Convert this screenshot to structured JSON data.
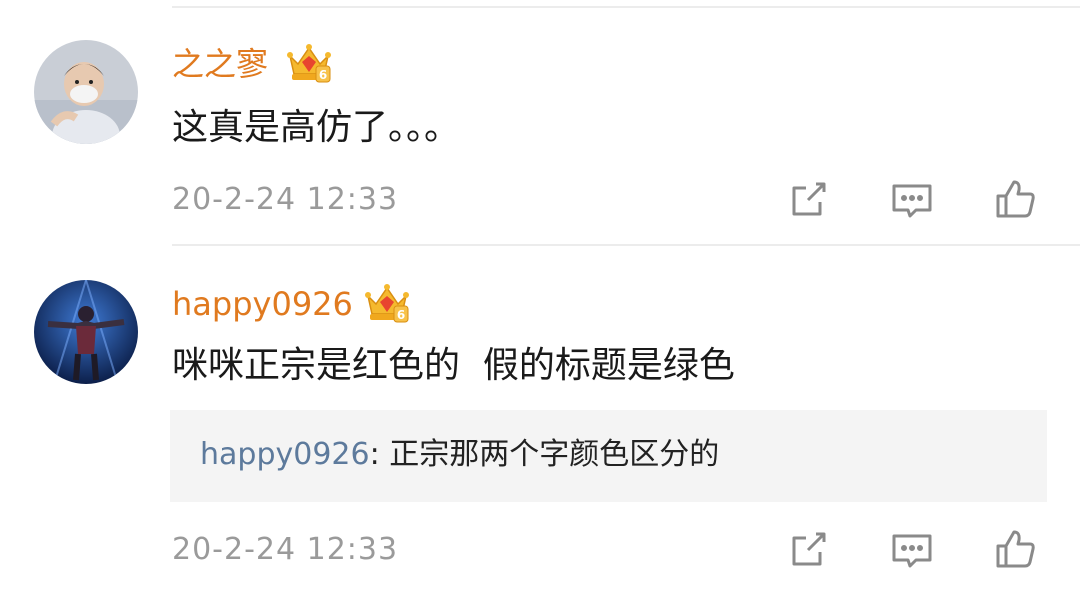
{
  "comments": [
    {
      "username": "之之寥",
      "level": "6",
      "text": "这真是高仿了。。。",
      "time": "20-2-24 12:33"
    },
    {
      "username": "happy0926",
      "level": "6",
      "text": "咪咪正宗是红色的  假的标题是绿色",
      "reply": {
        "user": "happy0926",
        "separator": ":",
        "text": " 正宗那两个字颜色区分的"
      },
      "time": "20-2-24 12:33"
    }
  ],
  "icons": {
    "share": "share-icon",
    "comment": "comment-icon",
    "like": "like-icon",
    "badge": "crown-badge-icon"
  },
  "colors": {
    "username": "#e07a1f",
    "reply_user": "#5d7a9c",
    "timestamp": "#9a9a9a",
    "reply_bg": "#f4f4f4"
  }
}
